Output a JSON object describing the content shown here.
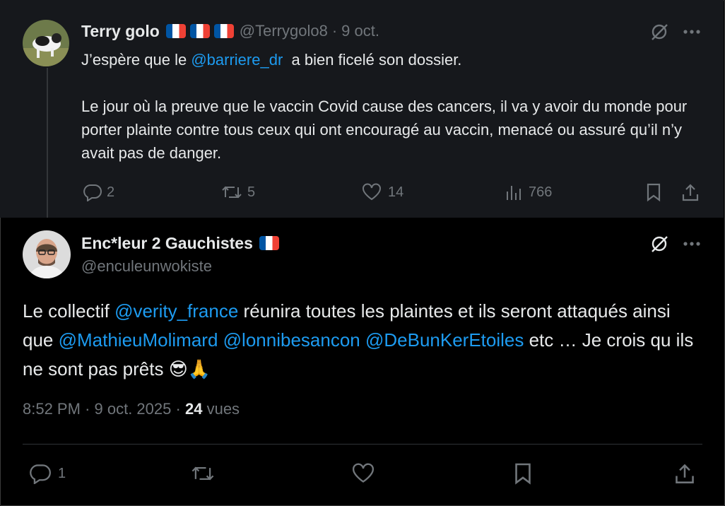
{
  "parent_tweet": {
    "author_name": "Terry golo",
    "handle": "@Terrygolo8",
    "separator": "·",
    "date": "9 oct.",
    "text_line1_before": "J’espère que le ",
    "text_line1_mention": "@barriere_dr",
    "text_line1_after": "  a bien ficelé son dossier.",
    "text_paragraph2": "Le jour où la preuve que le vaccin Covid cause des cancers, il va y avoir du monde pour porter plainte contre tous ceux qui ont encouragé au vaccin, menacé ou assuré qu’il n’y avait pas de danger.",
    "replies": "2",
    "reposts": "5",
    "likes": "14",
    "views": "766"
  },
  "main_tweet": {
    "author_name": "Enc*leur 2 Gauchistes",
    "handle": "@enculeunwokiste",
    "text_1": "Le collectif ",
    "mention_1": "@verity_france",
    "text_2": " réunira toutes les plaintes et ils seront attaqués ainsi que ",
    "mention_2": "@MathieuMolimard",
    "text_3": " ",
    "mention_3": "@lonnibesancon",
    "text_4": " ",
    "mention_4": "@DeBunKerEtoiles",
    "text_5": " etc … Je crois qu ils ne sont pas prêts ",
    "emojis": "😎🙏",
    "time": "8:52 PM",
    "date": "9 oct. 2025",
    "separator": "·",
    "views_count": "24",
    "views_label": "vues",
    "replies": "1"
  },
  "colors": {
    "background": "#000000",
    "parent_background": "#16181c",
    "text": "#e7e9ea",
    "secondary": "#71767b",
    "link": "#1d9bf0"
  }
}
